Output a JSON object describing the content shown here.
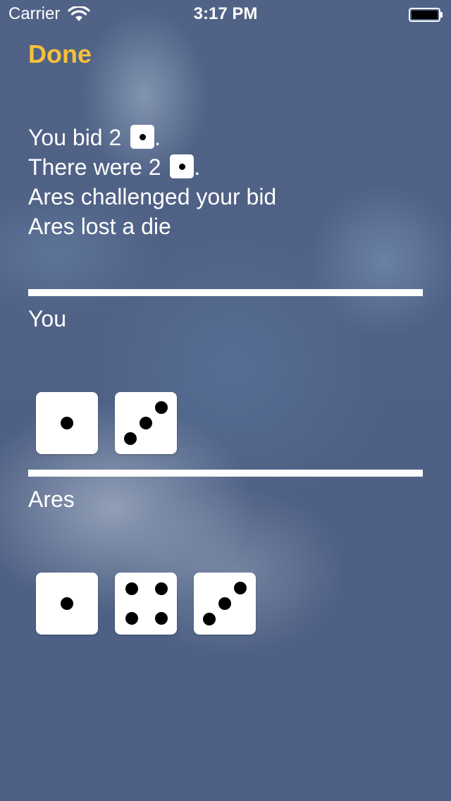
{
  "status_bar": {
    "carrier": "Carrier",
    "time": "3:17 PM"
  },
  "nav": {
    "done_label": "Done"
  },
  "summary": {
    "bid_prefix": "You bid 2",
    "bid_face": 1,
    "actual_prefix": "There were 2",
    "actual_face": 1,
    "period": ".",
    "challenge_text": "Ares challenged your bid",
    "outcome_text": "Ares lost a die"
  },
  "players": [
    {
      "name": "You",
      "dice": [
        1,
        3
      ]
    },
    {
      "name": "Ares",
      "dice": [
        1,
        4,
        3
      ]
    }
  ],
  "colors": {
    "accent": "#f6c13a",
    "background": "#4e6084",
    "text": "#ffffff",
    "die": "#ffffff",
    "pip": "#000000"
  }
}
